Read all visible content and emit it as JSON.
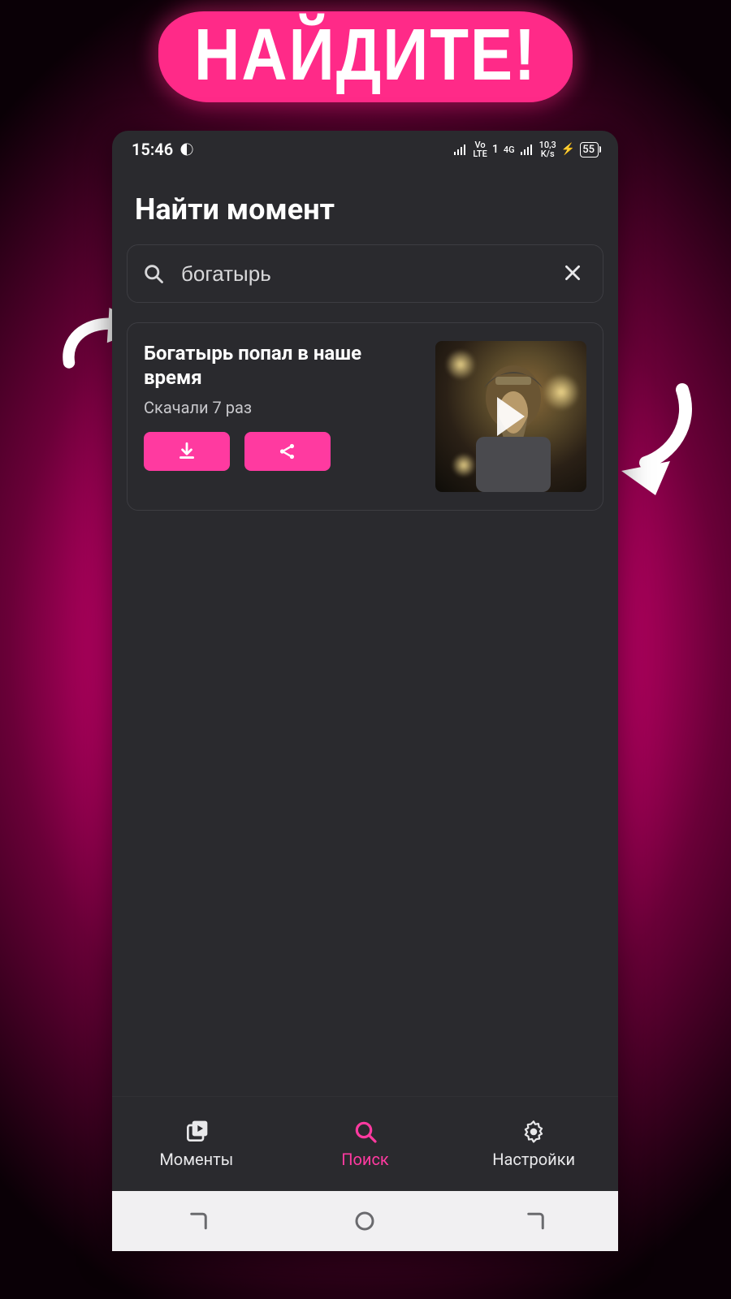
{
  "promo": {
    "headline": "НАЙДИТЕ!"
  },
  "statusbar": {
    "time": "15:46",
    "net1": "Vo\nLTE",
    "net2": "4G",
    "speed": "10,3\nK/s",
    "battery": "55"
  },
  "page": {
    "title": "Найти момент"
  },
  "search": {
    "value": "богатырь",
    "placeholder": ""
  },
  "result": {
    "title": "Богатырь попал в наше время",
    "downloads_label": "Скачали 7 раз"
  },
  "tabs": {
    "moments": "Моменты",
    "search": "Поиск",
    "settings": "Настройки"
  },
  "colors": {
    "accent": "#ff3aa0",
    "panel": "#2a2a2e"
  }
}
